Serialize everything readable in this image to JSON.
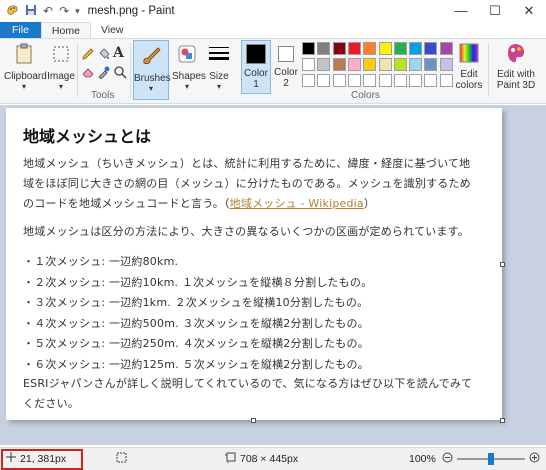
{
  "titlebar": {
    "title": "mesh.png - Paint"
  },
  "window": {
    "minimize": "—",
    "maximize": "☐",
    "close": "✕"
  },
  "tabs": [
    "File",
    "Home",
    "View"
  ],
  "ribbon": {
    "clipboard": "Clipboard",
    "image": "Image",
    "tools": "Tools",
    "brushes": "Brushes",
    "shapes": "Shapes",
    "size": "Size",
    "color1": "Color",
    "color1_num": "1",
    "color2": "Color",
    "color2_num": "2",
    "colors": "Colors",
    "edit_colors_1": "Edit",
    "edit_colors_2": "colors",
    "edit3d_1": "Edit with",
    "edit3d_2": "Paint 3D",
    "tool_text": "A"
  },
  "palette_colors": [
    "#000000",
    "#7f7f7f",
    "#880015",
    "#ed1c24",
    "#ff7f27",
    "#fff200",
    "#22b14c",
    "#00a2e8",
    "#3f48cc",
    "#a349a4",
    "#ffffff",
    "#c3c3c3",
    "#b97a57",
    "#ffaec9",
    "#ffc90e",
    "#efe4b0",
    "#b5e61d",
    "#99d9ea",
    "#7092be",
    "#c8bfe7",
    "#ffffff",
    "#ffffff",
    "#ffffff",
    "#ffffff",
    "#ffffff",
    "#ffffff",
    "#ffffff",
    "#ffffff",
    "#ffffff",
    "#ffffff"
  ],
  "doc": {
    "title": "地域メッシュとは",
    "p1_l1": "地域メッシュ（ちいきメッシュ）とは、統計に利用するために、緯度・経度に基づいて地",
    "p1_l2": "域をほぼ同じ大きさの網の目（メッシュ）に分けたものである。メッシュを識別するため",
    "p1_l3a": "のコードを地域メッシュコードと言う。（",
    "p1_link": "地域メッシュ - Wikipedia",
    "p1_l3b": "）",
    "p2": "地域メッシュは区分の方法により、大きさの異なるいくつかの区画が定められています。",
    "list": [
      "・１次メッシュ: 一辺約80km.",
      "・２次メッシュ: 一辺約10km. １次メッシュを縦横８分割したもの。",
      "・３次メッシュ: 一辺約1km. ２次メッシュを縦横10分割したもの。",
      "・４次メッシュ: 一辺約500m. ３次メッシュを縦横2分割したもの。",
      "・５次メッシュ: 一辺約250m. ４次メッシュを縦横2分割したもの。",
      "・６次メッシュ: 一辺約125m. ５次メッシュを縦横2分割したもの。"
    ],
    "p3_l1": "ESRIジャパンさんが詳しく説明してくれているので、気になる方はぜひ以下を読んでみて",
    "p3_l2": "ください。"
  },
  "status": {
    "cursor": "21, 381px",
    "image_size": "708 × 445px",
    "zoom": "100%",
    "zoom_level": 0.5
  }
}
